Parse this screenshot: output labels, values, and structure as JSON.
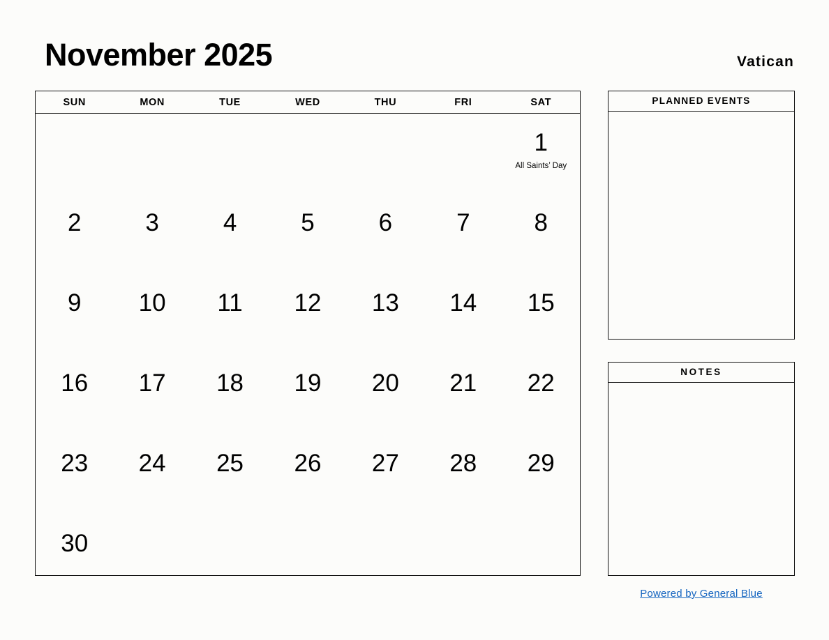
{
  "header": {
    "month_title": "November 2025",
    "country": "Vatican"
  },
  "calendar": {
    "weekday_labels": [
      "SUN",
      "MON",
      "TUE",
      "WED",
      "THU",
      "FRI",
      "SAT"
    ],
    "weeks": [
      [
        {
          "day": "",
          "event": ""
        },
        {
          "day": "",
          "event": ""
        },
        {
          "day": "",
          "event": ""
        },
        {
          "day": "",
          "event": ""
        },
        {
          "day": "",
          "event": ""
        },
        {
          "day": "",
          "event": ""
        },
        {
          "day": "1",
          "event": "All Saints’ Day"
        }
      ],
      [
        {
          "day": "2",
          "event": ""
        },
        {
          "day": "3",
          "event": ""
        },
        {
          "day": "4",
          "event": ""
        },
        {
          "day": "5",
          "event": ""
        },
        {
          "day": "6",
          "event": ""
        },
        {
          "day": "7",
          "event": ""
        },
        {
          "day": "8",
          "event": ""
        }
      ],
      [
        {
          "day": "9",
          "event": ""
        },
        {
          "day": "10",
          "event": ""
        },
        {
          "day": "11",
          "event": ""
        },
        {
          "day": "12",
          "event": ""
        },
        {
          "day": "13",
          "event": ""
        },
        {
          "day": "14",
          "event": ""
        },
        {
          "day": "15",
          "event": ""
        }
      ],
      [
        {
          "day": "16",
          "event": ""
        },
        {
          "day": "17",
          "event": ""
        },
        {
          "day": "18",
          "event": ""
        },
        {
          "day": "19",
          "event": ""
        },
        {
          "day": "20",
          "event": ""
        },
        {
          "day": "21",
          "event": ""
        },
        {
          "day": "22",
          "event": ""
        }
      ],
      [
        {
          "day": "23",
          "event": ""
        },
        {
          "day": "24",
          "event": ""
        },
        {
          "day": "25",
          "event": ""
        },
        {
          "day": "26",
          "event": ""
        },
        {
          "day": "27",
          "event": ""
        },
        {
          "day": "28",
          "event": ""
        },
        {
          "day": "29",
          "event": ""
        }
      ],
      [
        {
          "day": "30",
          "event": ""
        },
        {
          "day": "",
          "event": ""
        },
        {
          "day": "",
          "event": ""
        },
        {
          "day": "",
          "event": ""
        },
        {
          "day": "",
          "event": ""
        },
        {
          "day": "",
          "event": ""
        },
        {
          "day": "",
          "event": ""
        }
      ]
    ]
  },
  "panels": {
    "planned_events_title": "PLANNED EVENTS",
    "notes_title": "NOTES"
  },
  "footer": {
    "link_text": "Powered by General Blue",
    "link_color": "#1565c0"
  }
}
